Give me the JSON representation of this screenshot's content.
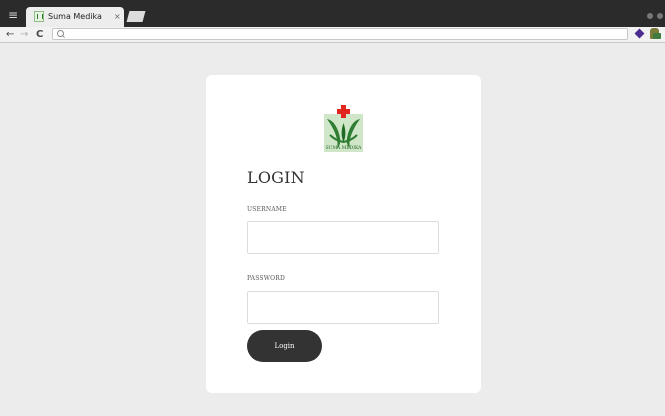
{
  "browser": {
    "tab": {
      "title": "Suma Medika",
      "close_glyph": "×",
      "favicon": "suma-medika-favicon"
    },
    "toolbar": {
      "back_glyph": "←",
      "forward_glyph": "→",
      "reload_glyph": "C",
      "address_value": "",
      "extensions": [
        "purple-gem-extension-icon",
        "green-puzzle-extension-icon"
      ]
    }
  },
  "login": {
    "title": "LOGIN",
    "username_label": "USERNAME",
    "username_value": "",
    "password_label": "PASSWORD",
    "password_value": "",
    "button_label": "Login",
    "logo_text": "SUMA MEDIKA"
  },
  "colors": {
    "page_background": "#ececec",
    "card_background": "#ffffff",
    "button_background": "#333333",
    "button_text": "#ffffff",
    "logo_green": "#2e7d32",
    "logo_cross_red": "#e0261f",
    "title_text": "#333333"
  }
}
